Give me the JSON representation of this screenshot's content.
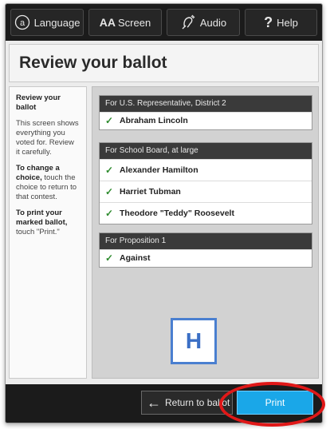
{
  "toolbar": {
    "language": "Language",
    "screen_prefix": "AA",
    "screen": "Screen",
    "audio": "Audio",
    "help_glyph": "?",
    "help": "Help"
  },
  "page_title": "Review your ballot",
  "sidebar": {
    "heading": "Review your ballot",
    "intro": "This screen shows everything you voted for. Review it carefully.",
    "change_bold": "To change a choice,",
    "change_rest": "touch the choice to return to that contest.",
    "print_bold": "To print your marked ballot,",
    "print_rest": "touch \"Print.\""
  },
  "contests": [
    {
      "title": "For U.S. Representative, District 2",
      "choices": [
        "Abraham Lincoln"
      ]
    },
    {
      "title": "For School Board, at large",
      "choices": [
        "Alexander Hamilton",
        "Harriet Tubman",
        "Theodore \"Teddy\" Roosevelt"
      ]
    },
    {
      "title": "For Proposition 1",
      "choices": [
        "Against"
      ]
    }
  ],
  "check_glyph": "✓",
  "annotation_label": "H",
  "bottom": {
    "return_arrow": "←",
    "return_label": "Return to ballot",
    "print_label": "Print"
  },
  "colors": {
    "print_button": "#1aa7e8",
    "annotation_circle": "#e01818",
    "annotation_box": "#4a7fd0",
    "checkmark": "#2e8b2e"
  },
  "icons": [
    "language-icon",
    "audio-icon",
    "help-icon",
    "checkmark-icon",
    "arrow-left-icon"
  ]
}
